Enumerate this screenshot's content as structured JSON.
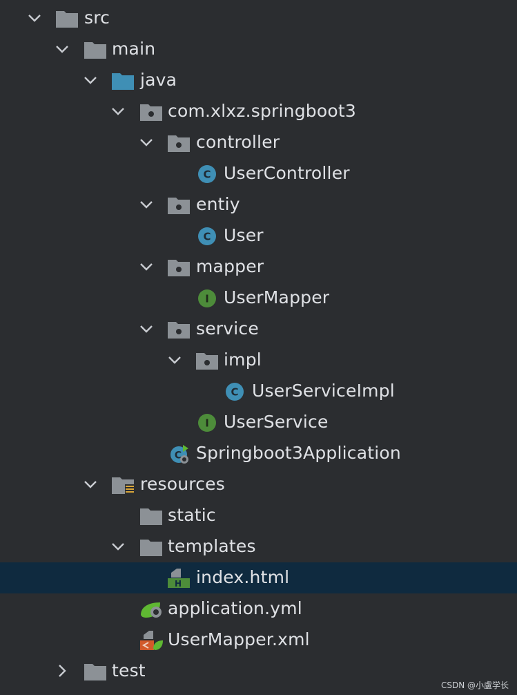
{
  "tree": {
    "nodes": [
      {
        "label": "src"
      },
      {
        "label": "main"
      },
      {
        "label": "java"
      },
      {
        "label": "com.xlxz.springboot3"
      },
      {
        "label": "controller"
      },
      {
        "label": "UserController",
        "badge": "C"
      },
      {
        "label": "entiy"
      },
      {
        "label": "User",
        "badge": "C"
      },
      {
        "label": "mapper"
      },
      {
        "label": "UserMapper",
        "badge": "I"
      },
      {
        "label": "service"
      },
      {
        "label": "impl"
      },
      {
        "label": "UserServiceImpl",
        "badge": "C"
      },
      {
        "label": "UserService",
        "badge": "I"
      },
      {
        "label": "Springboot3Application",
        "badge": "C"
      },
      {
        "label": "resources"
      },
      {
        "label": "static"
      },
      {
        "label": "templates"
      },
      {
        "label": "index.html",
        "badge": "H"
      },
      {
        "label": "application.yml"
      },
      {
        "label": "UserMapper.xml"
      },
      {
        "label": "test"
      }
    ]
  },
  "watermark": "CSDN @小盧学长",
  "colors": {
    "background": "#2b2d30",
    "selected_row": "#0f2a3f",
    "folder_gray": "#8c9196",
    "folder_blue": "#3f8fb5",
    "class_blue": "#3f8fb5",
    "interface_green": "#4d8c3a",
    "text": "#dfe1e5"
  }
}
